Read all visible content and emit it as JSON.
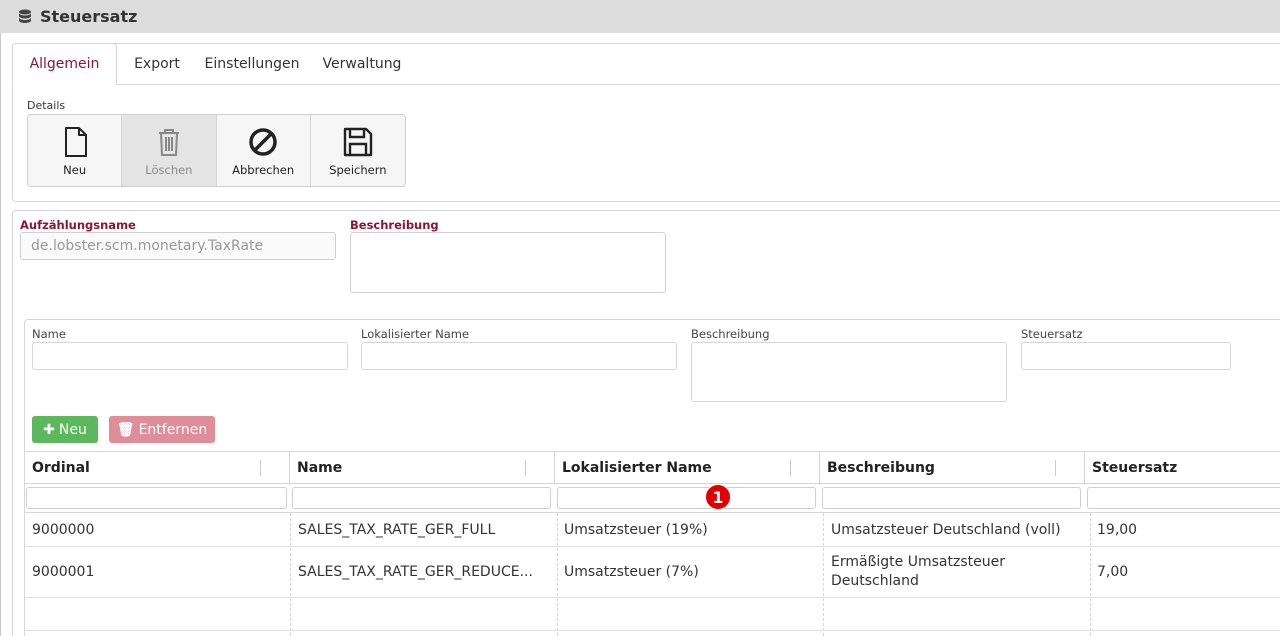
{
  "window": {
    "title": "Steuersatz"
  },
  "tabs": [
    {
      "label": "Allgemein",
      "active": true
    },
    {
      "label": "Export"
    },
    {
      "label": "Einstellungen"
    },
    {
      "label": "Verwaltung"
    }
  ],
  "details": {
    "label": "Details",
    "buttons": [
      {
        "label": "Neu"
      },
      {
        "label": "Löschen",
        "disabled": true
      },
      {
        "label": "Abbrechen"
      },
      {
        "label": "Speichern"
      }
    ]
  },
  "form": {
    "enum_name_label": "Aufzählungsname",
    "enum_name_value": "de.lobster.scm.monetary.TaxRate",
    "description_label": "Beschreibung"
  },
  "entry": {
    "name_label": "Name",
    "localized_label": "Lokalisierter Name",
    "description_label": "Beschreibung",
    "rate_label": "Steuersatz"
  },
  "actions": {
    "new_label": "Neu",
    "remove_label": "Entfernen"
  },
  "grid": {
    "columns": [
      "Ordinal",
      "Name",
      "Lokalisierter Name",
      "Beschreibung",
      "Steuersatz"
    ],
    "rows": [
      [
        "9000000",
        "SALES_TAX_RATE_GER_FULL",
        "Umsatzsteuer (19%)",
        "Umsatzsteuer Deutschland (voll)",
        "19,00"
      ],
      [
        "9000001",
        "SALES_TAX_RATE_GER_REDUCE...",
        "Umsatzsteuer (7%)",
        "Ermäßigte Umsatzsteuer Deutschland",
        "7,00"
      ]
    ]
  },
  "annotation": {
    "badge": "1",
    "color": "#e00000"
  },
  "colors": {
    "accent": "#8b1438",
    "success": "#5cb85c",
    "danger": "#e08d9a"
  }
}
